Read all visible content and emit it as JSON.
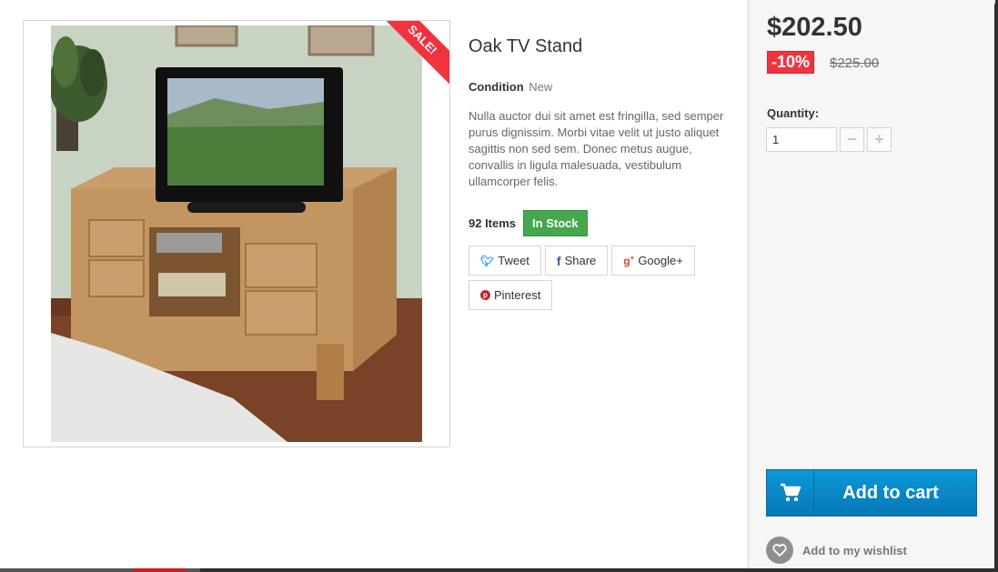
{
  "product": {
    "title": "Oak TV Stand",
    "sale_label": "Sale!",
    "condition_label": "Condition",
    "condition_value": "New",
    "description": "Nulla auctor dui sit amet est fringilla, sed semper purus dignissim. Morbi vitae velit ut justo aliquet sagittis non sed sem. Donec metus augue, convallis in ligula malesuada, vestibulum ullamcorper felis.",
    "stock_count": "92 Items",
    "stock_status": "In Stock"
  },
  "share": {
    "tweet": "Tweet",
    "share": "Share",
    "googleplus": "Google+",
    "pinterest": "Pinterest",
    "icons": [
      "twitter-icon",
      "facebook-icon",
      "google-plus-icon",
      "pinterest-icon"
    ]
  },
  "pricing": {
    "price": "$202.50",
    "discount": "-10%",
    "old_price": "$225.00"
  },
  "cart": {
    "quantity_label": "Quantity:",
    "quantity_value": "1",
    "minus": "−",
    "plus": "+",
    "add_to_cart": "Add to cart",
    "wishlist": "Add to my wishlist"
  },
  "colors": {
    "sale_red": "#f13340",
    "stock_green": "#46a74e",
    "cart_blue": "#0b98d6"
  }
}
